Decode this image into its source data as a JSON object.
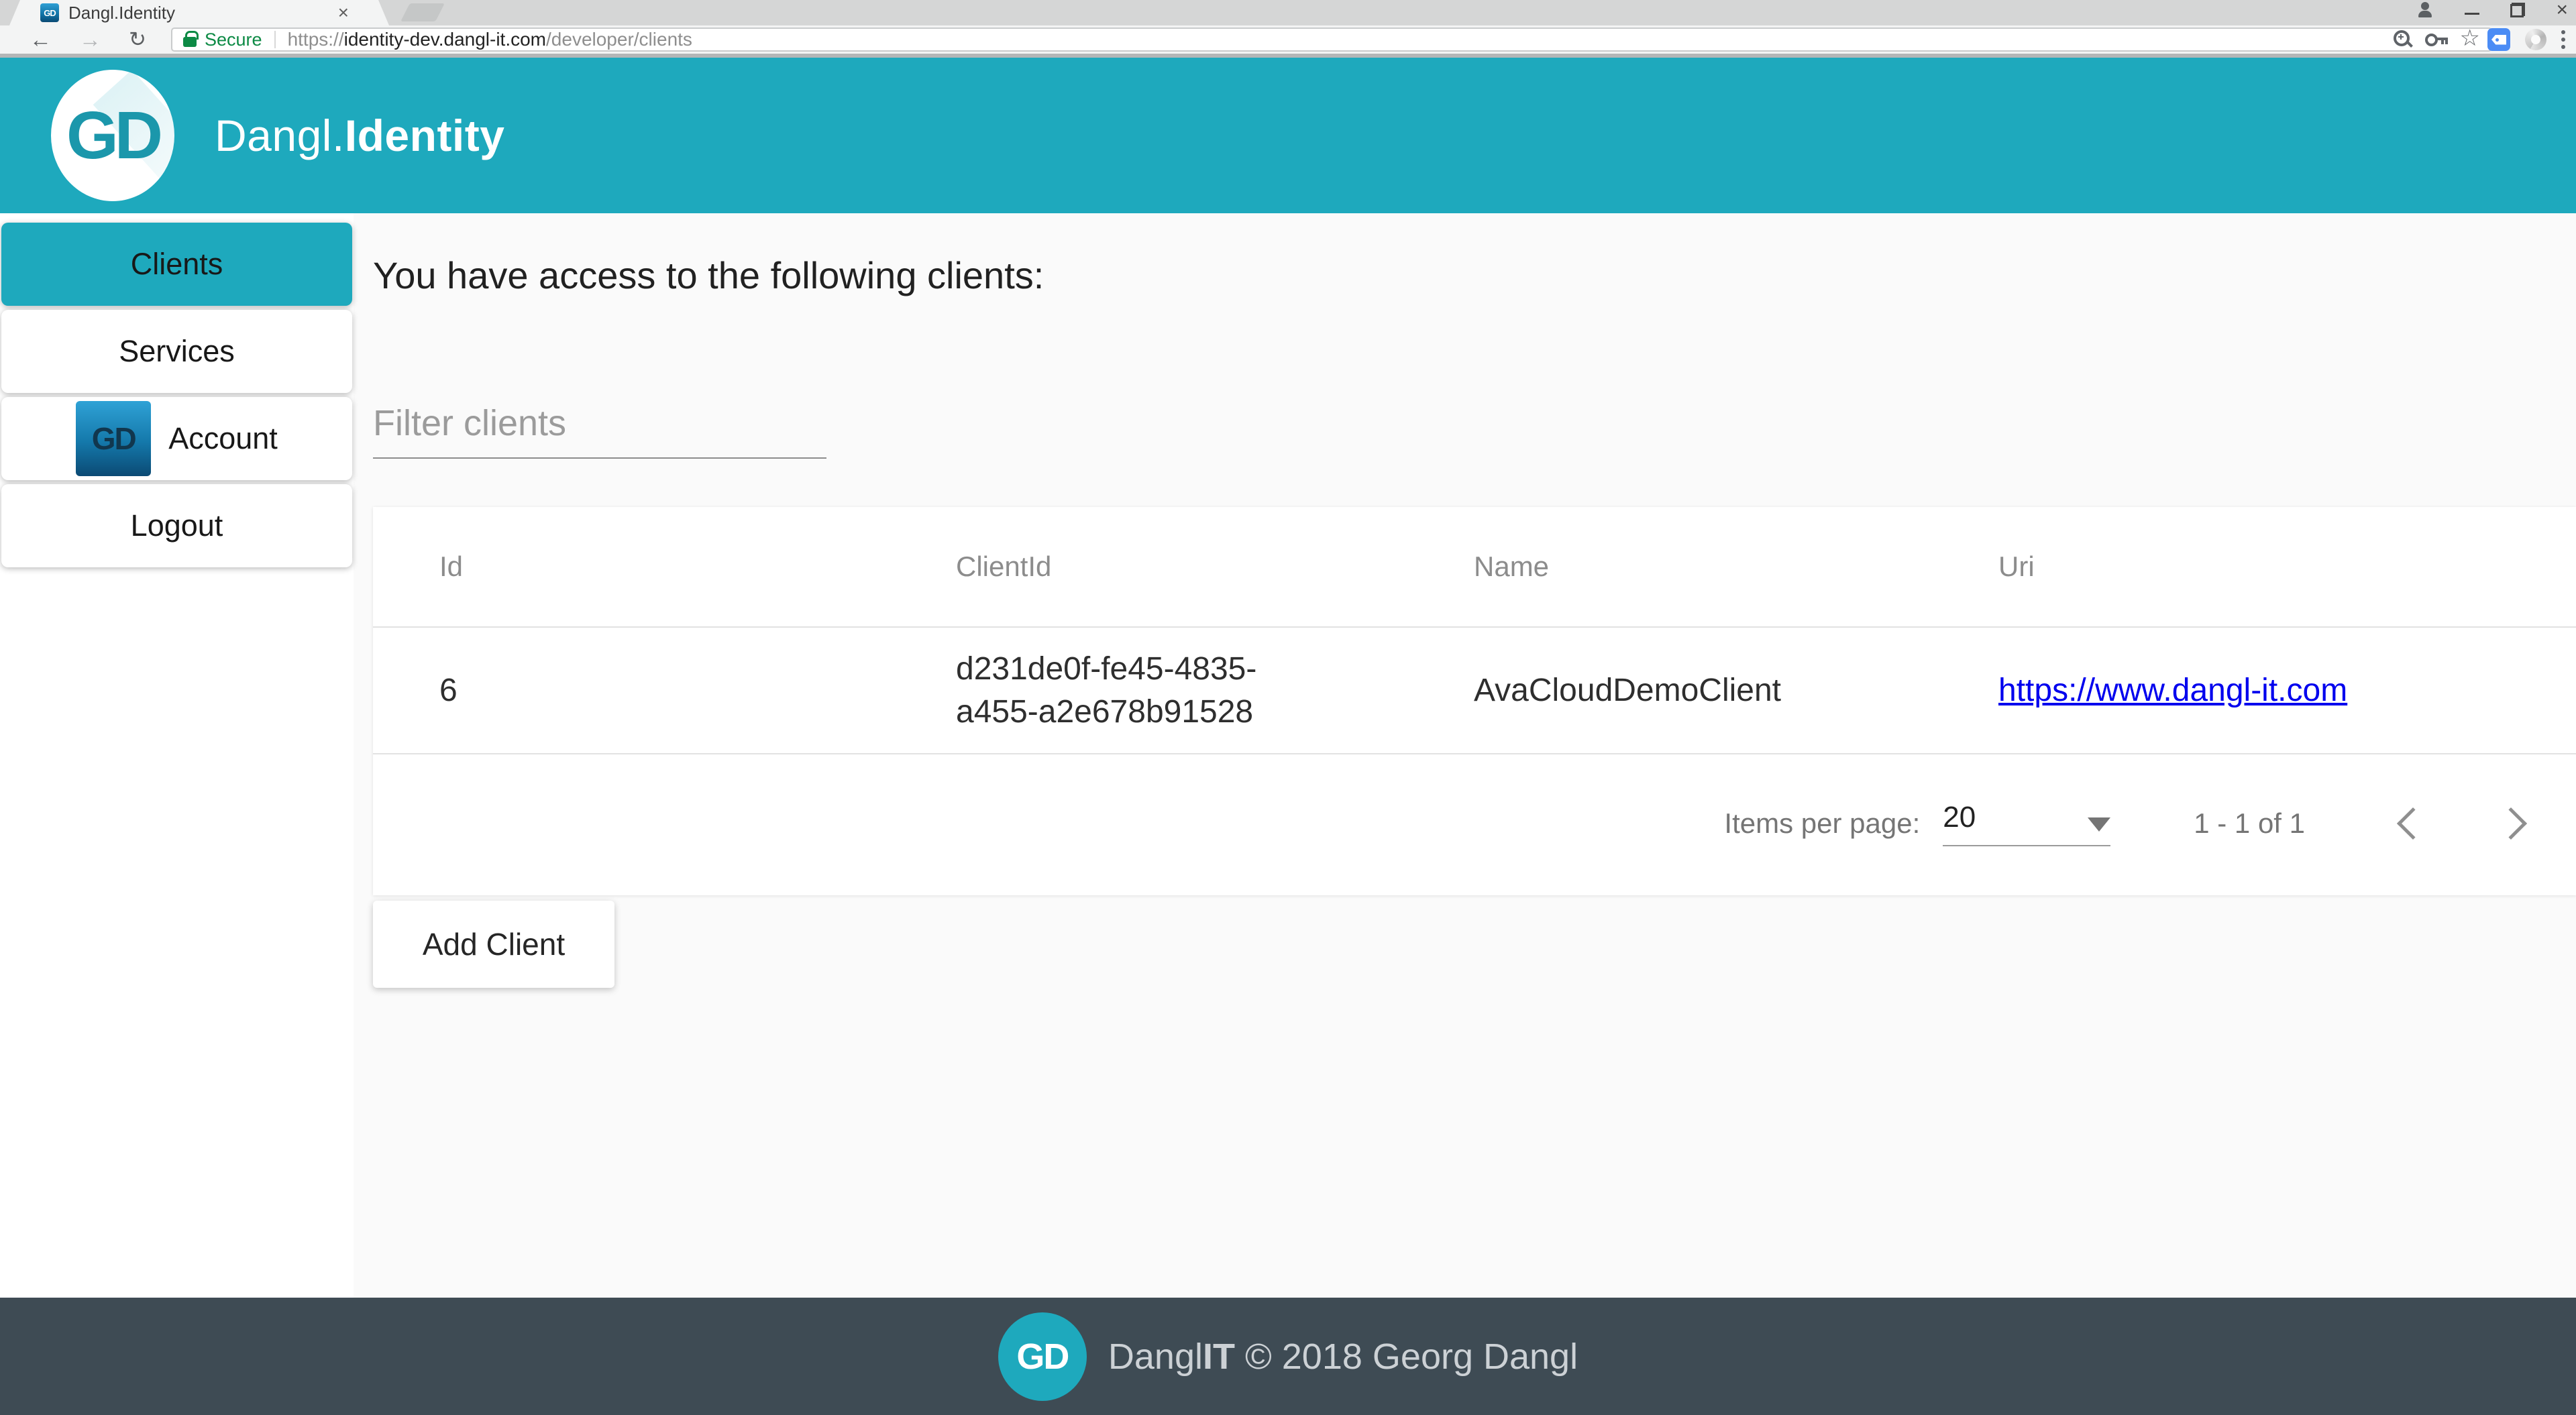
{
  "browser": {
    "tab": {
      "title": "Dangl.Identity",
      "favicon_text": "GD",
      "close_glyph": "×"
    },
    "toolbar": {
      "security_label": "Secure",
      "url_scheme": "https://",
      "url_host": "identity-dev.dangl-it.com",
      "url_path": "/developer/clients"
    }
  },
  "header": {
    "logo_text": "GD",
    "title_regular": "Dangl.",
    "title_bold": "Identity"
  },
  "sidebar": {
    "items": [
      {
        "label": "Clients",
        "active": true
      },
      {
        "label": "Services"
      },
      {
        "label": "Account",
        "icon_text": "GD"
      },
      {
        "label": "Logout"
      }
    ]
  },
  "main": {
    "heading": "You have access to the following clients:",
    "filter_placeholder": "Filter clients",
    "table": {
      "columns": [
        "Id",
        "ClientId",
        "Name",
        "Uri"
      ],
      "rows": [
        {
          "id": "6",
          "client_id": "d231de0f-fe45-4835-a455-a2e678b91528",
          "name": "AvaCloudDemoClient",
          "uri": "https://www.dangl-it.com"
        }
      ]
    },
    "paginator": {
      "items_per_page_label": "Items per page:",
      "page_size": "20",
      "range_label": "1 - 1 of 1"
    },
    "add_button_label": "Add Client"
  },
  "footer": {
    "logo_text": "GD",
    "brand_regular": "Dangl",
    "brand_bold": "IT",
    "copyright": " © 2018 Georg Dangl"
  },
  "colors": {
    "header_teal": "#1EA9BD",
    "footer_bg": "#3E4B54",
    "link_blue": "#0000EE",
    "secure_green": "#0D8A45"
  }
}
